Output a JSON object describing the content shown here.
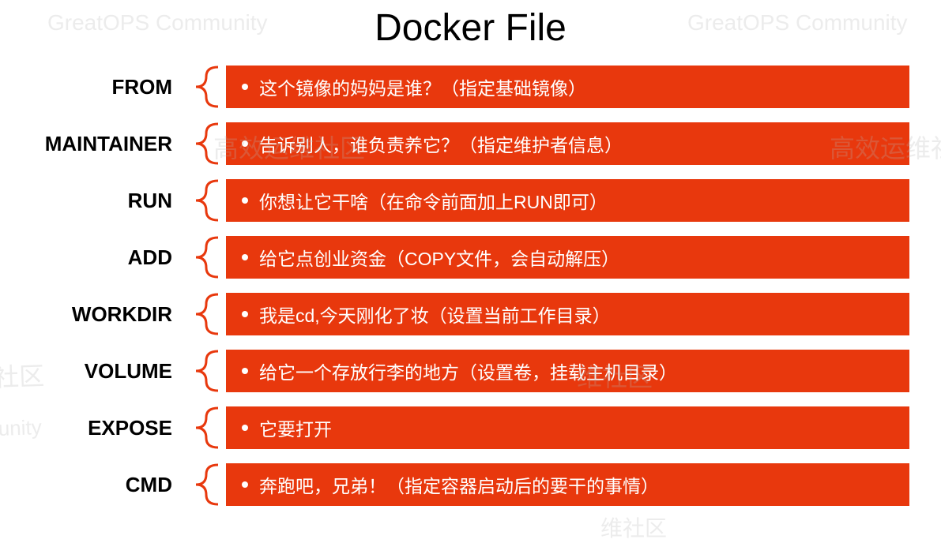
{
  "title": "Docker File",
  "rows": [
    {
      "label": "FROM",
      "description": "这个镜像的妈妈是谁？（指定基础镜像）"
    },
    {
      "label": "MAINTAINER",
      "description": "告诉别人，谁负责养它？（指定维护者信息）"
    },
    {
      "label": "RUN",
      "description": "你想让它干啥（在命令前面加上RUN即可）"
    },
    {
      "label": "ADD",
      "description": "给它点创业资金（COPY文件，会自动解压）"
    },
    {
      "label": "WORKDIR",
      "description": "我是cd,今天刚化了妆（设置当前工作目录）"
    },
    {
      "label": "VOLUME",
      "description": "给它一个存放行李的地方（设置卷，挂载主机目录）"
    },
    {
      "label": "EXPOSE",
      "description": "它要打开"
    },
    {
      "label": "CMD",
      "description": "奔跑吧，兄弟！（指定容器启动后的要干的事情）"
    }
  ],
  "colors": {
    "box_bg": "#e8380d",
    "box_text": "#ffffff",
    "brace": "#e8380d",
    "title": "#000000",
    "label": "#000000"
  },
  "watermarks": {
    "community": "GreatOPS Community",
    "community_cn": "高效运维社区",
    "community_short": "维社区",
    "short2": "ommunity",
    "short3": "维社区"
  }
}
